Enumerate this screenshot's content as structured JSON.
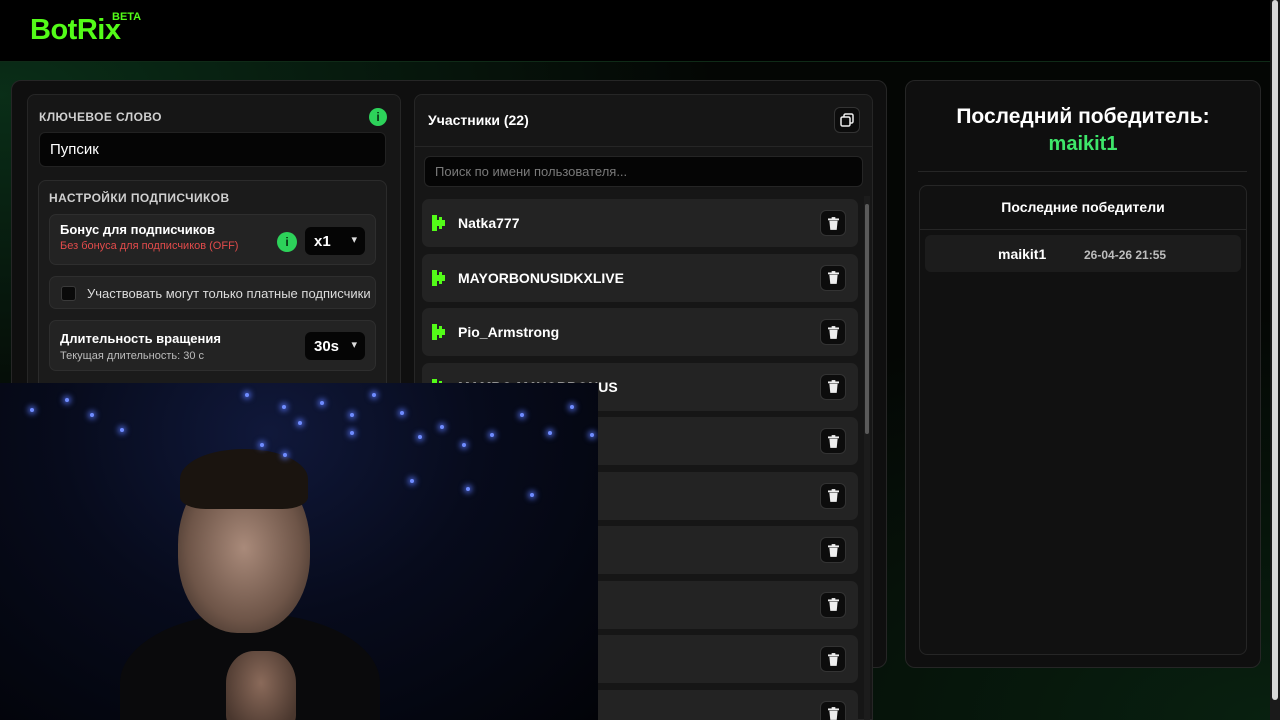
{
  "brand": {
    "name": "BotRix",
    "tag": "BETA",
    "accent": "#53fc18"
  },
  "settings": {
    "keyword_label": "КЛЮЧЕВОЕ СЛОВО",
    "keyword_value": "Пупсик",
    "subscriber_section_label": "НАСТРОЙКИ ПОДПИСЧИКОВ",
    "bonus": {
      "title": "Бонус для подписчиков",
      "subtitle": "Без бонуса для подписчиков (OFF)",
      "selected": "x1"
    },
    "paid_only": {
      "label": "Участвовать могут только платные подписчики",
      "checked": false
    },
    "spin": {
      "title": "Длительность вращения",
      "subtitle": "Текущая длительность: 30 с",
      "selected": "30s"
    }
  },
  "participants": {
    "title": "Участники (22)",
    "search_placeholder": "Поиск по имени пользователя...",
    "items": [
      {
        "name": "Natka777"
      },
      {
        "name": "MAYORBONUSIDKXLIVE"
      },
      {
        "name": "Pio_Armstrong"
      },
      {
        "name": "MAMBO MAYORBONUS"
      },
      {
        "name": ""
      },
      {
        "name": ""
      },
      {
        "name": ""
      },
      {
        "name": ""
      },
      {
        "name": ""
      },
      {
        "name": ""
      }
    ]
  },
  "winner": {
    "title": "Последний победитель:",
    "name": "maikit1",
    "recent_title": "Последние победители",
    "recent": [
      {
        "name": "maikit1",
        "time": "26-04-26 21:55"
      }
    ]
  },
  "icons": {
    "info": "info-icon",
    "copy": "copy-icon",
    "trash": "trash-icon",
    "kick": "kick-logo-icon",
    "chevron": "chevron-down-icon"
  }
}
